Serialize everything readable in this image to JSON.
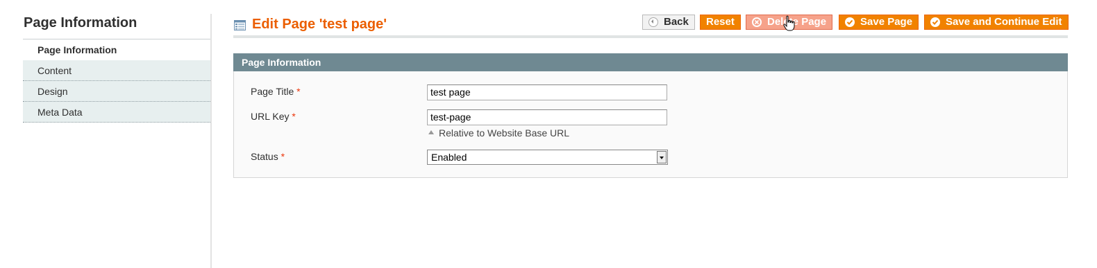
{
  "sidebar": {
    "title": "Page Information",
    "items": [
      {
        "label": "Page Information",
        "active": true
      },
      {
        "label": "Content",
        "active": false
      },
      {
        "label": "Design",
        "active": false
      },
      {
        "label": "Meta Data",
        "active": false
      }
    ]
  },
  "header": {
    "title": "Edit Page 'test page'",
    "buttons": {
      "back": "Back",
      "reset": "Reset",
      "delete": "Delete Page",
      "save": "Save Page",
      "save_continue": "Save and Continue Edit"
    }
  },
  "section": {
    "title": "Page Information",
    "fields": {
      "page_title": {
        "label": "Page Title",
        "required": "*",
        "value": "test page"
      },
      "url_key": {
        "label": "URL Key",
        "required": "*",
        "value": "test-page",
        "note": "Relative to Website Base URL"
      },
      "status": {
        "label": "Status",
        "required": "*",
        "value": "Enabled"
      }
    }
  },
  "colors": {
    "accent": "#eb5e00",
    "button": "#f18200",
    "section_header": "#6f8992",
    "sidebar_item_bg": "#e7efef"
  }
}
